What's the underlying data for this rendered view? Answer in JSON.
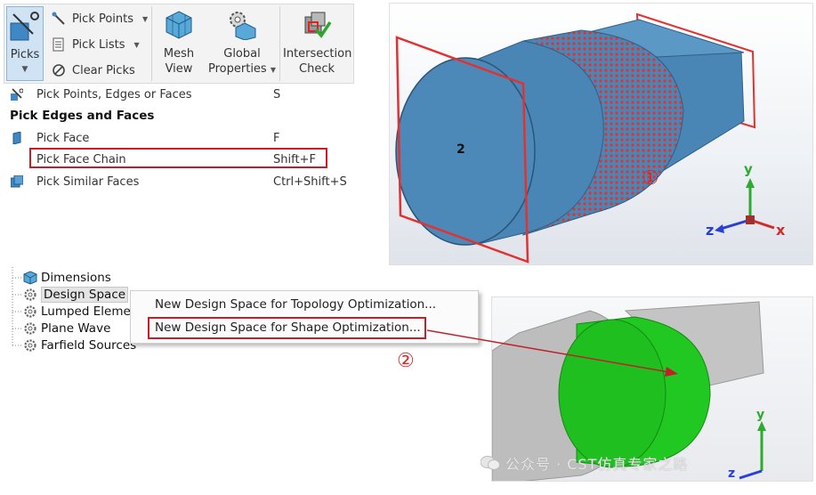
{
  "ribbon": {
    "picks_label": "Picks",
    "pick_points_label": "Pick Points",
    "pick_lists_label": "Pick Lists",
    "clear_picks_label": "Clear Picks",
    "mesh_view_label": [
      "Mesh",
      "View"
    ],
    "global_properties_label": [
      "Global",
      "Properties"
    ],
    "intersection_check_label": [
      "Intersection",
      "Check"
    ]
  },
  "pick_menu": {
    "top_item": {
      "label": "Pick Points, Edges or Faces",
      "shortcut": "S"
    },
    "section_header": "Pick Edges and Faces",
    "items": [
      {
        "label": "Pick Face",
        "shortcut": "F"
      },
      {
        "label": "Pick Face Chain",
        "shortcut": "Shift+F"
      },
      {
        "label": "Pick Similar Faces",
        "shortcut": "Ctrl+Shift+S"
      }
    ]
  },
  "viewport_top": {
    "face_label": "2",
    "step_marker": "①",
    "axes": {
      "x": "x",
      "y": "y",
      "z": "z"
    }
  },
  "tree": {
    "items": [
      "Dimensions",
      "Design Space",
      "Lumped Eleme",
      "Plane Wave",
      "Farfield Sources"
    ]
  },
  "context_menu": {
    "items": [
      "New Design Space for Topology Optimization...",
      "New Design Space for Shape Optimization..."
    ]
  },
  "step_marker_2": "②",
  "viewport_bottom": {
    "axes": {
      "y": "y",
      "z": "z"
    }
  },
  "watermark": "公众号 · CST仿真专家之路",
  "colors": {
    "highlight_border": "#c0202a",
    "model_blue": "#4a86b5",
    "pick_red": "#e53030",
    "design_green": "#22c822",
    "axis_x": "#d42a2a",
    "axis_y": "#2eaa2e",
    "axis_z": "#2a3fd4"
  }
}
